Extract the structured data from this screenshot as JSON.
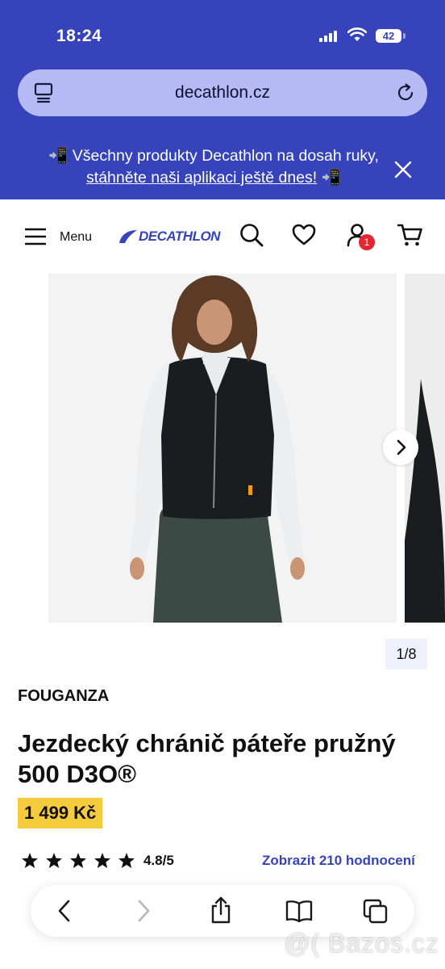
{
  "status_bar": {
    "time": "18:24",
    "battery": "42"
  },
  "browser": {
    "url": "decathlon.cz"
  },
  "promo": {
    "emoji_left": "📲",
    "text": " Všechny produkty Decathlon na dosah ruky, ",
    "link": "stáhněte naši aplikaci ještě dnes!",
    "emoji_right": " 📲"
  },
  "header": {
    "menu_label": "Menu",
    "logo_text": "DECATHLON",
    "cart_badge_count": "1"
  },
  "gallery": {
    "counter": "1/8"
  },
  "product": {
    "brand": "FOUGANZA",
    "title": "Jezdecký chránič páteře pružný 500 D3O®",
    "price": "1 499 Kč",
    "rating": "4.8/5",
    "reviews_link": "Zobrazit 210 hodnocení",
    "stars_filled": 5
  },
  "watermark": "@( Bazos.cz",
  "colors": {
    "brand_blue": "#3643ba",
    "price_yellow": "#f5cb3e",
    "badge_red": "#e3262f"
  }
}
